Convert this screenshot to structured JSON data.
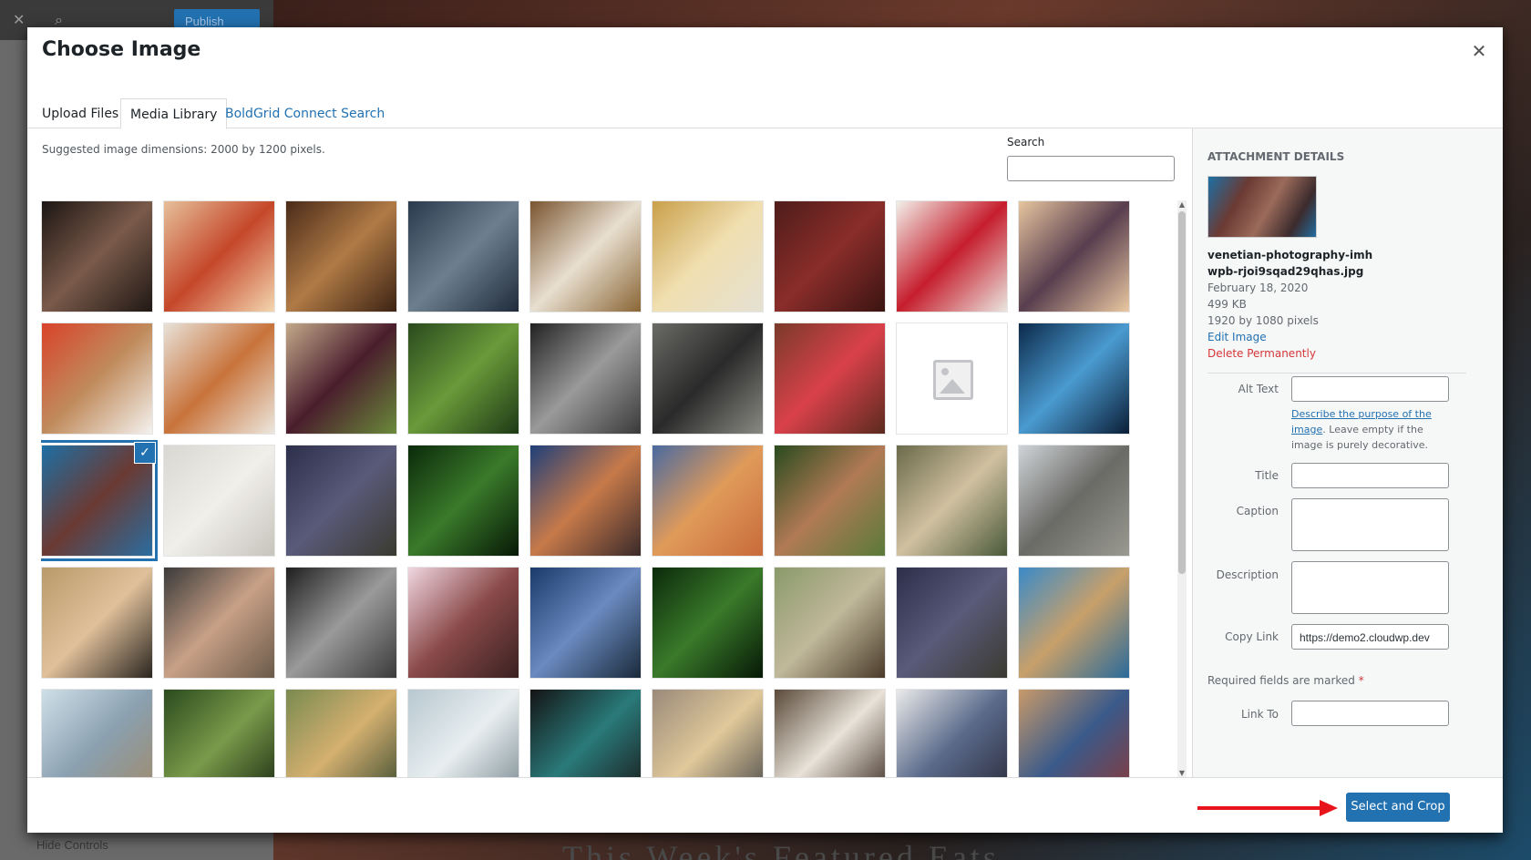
{
  "background": {
    "publish_label": "Publish",
    "hide_controls_label": "Hide Controls",
    "footer_text": "This Week's Featured Eats"
  },
  "modal": {
    "title": "Choose Image",
    "tabs": [
      {
        "label": "Upload Files"
      },
      {
        "label": "Media Library"
      },
      {
        "label": "BoldGrid Connect Search"
      }
    ],
    "suggested": "Suggested image dimensions: 2000 by 1200 pixels.",
    "search_label": "Search"
  },
  "library": {
    "selected_index": 18,
    "thumbs": [
      {
        "name": "friends-eating-popcorn",
        "colors": [
          "#1c1613",
          "#7a5a4a",
          "#201815"
        ]
      },
      {
        "name": "pizza",
        "colors": [
          "#e6c09a",
          "#c5472a",
          "#f3d6b0"
        ]
      },
      {
        "name": "sandwich",
        "colors": [
          "#4a2b19",
          "#b07a45",
          "#3c2314"
        ]
      },
      {
        "name": "sandwich-dark",
        "colors": [
          "#2a3a4d",
          "#6d7f8f",
          "#1f2b3a"
        ]
      },
      {
        "name": "spaghetti",
        "colors": [
          "#7a5530",
          "#e8dfd0",
          "#8a6636"
        ]
      },
      {
        "name": "pasta-rice",
        "colors": [
          "#c9a04a",
          "#f0dfb0",
          "#e5e0d3"
        ]
      },
      {
        "name": "jam-jars",
        "colors": [
          "#4e1d1a",
          "#8a2d2a",
          "#3a1412"
        ]
      },
      {
        "name": "raspberries",
        "colors": [
          "#f2efe9",
          "#c61e2d",
          "#eae6e0"
        ]
      },
      {
        "name": "salad-bowl",
        "colors": [
          "#e7c59f",
          "#583e4e",
          "#eac8a2"
        ]
      },
      {
        "name": "coffee-cup",
        "colors": [
          "#d9432b",
          "#c08b5c",
          "#f4f2ef"
        ]
      },
      {
        "name": "curry-pot",
        "colors": [
          "#e8e2d8",
          "#c8733b",
          "#ece7de"
        ]
      },
      {
        "name": "onion-pepper",
        "colors": [
          "#c3a98a",
          "#4a1d2d",
          "#6a8a3a"
        ]
      },
      {
        "name": "green-beans",
        "colors": [
          "#2a4a1e",
          "#6a9a3a",
          "#1e3a16"
        ]
      },
      {
        "name": "kitchen-counter",
        "colors": [
          "#222222",
          "#9a9a9a",
          "#3a3a3a"
        ]
      },
      {
        "name": "chef-kitchen",
        "colors": [
          "#6a6a66",
          "#2a2a2a",
          "#8a8a84"
        ]
      },
      {
        "name": "restaurant-street",
        "colors": [
          "#7a3a2a",
          "#d9414a",
          "#5a2a1f"
        ]
      },
      {
        "name": "no-image",
        "colors": [
          "#ffffff",
          "#ffffff",
          "#ffffff"
        ],
        "placeholder": true
      },
      {
        "name": "city-light-trails",
        "colors": [
          "#0c2a4a",
          "#4a9ad0",
          "#0b1e36"
        ]
      },
      {
        "name": "venetian-photography",
        "colors": [
          "#1d6fa5",
          "#6b3a33",
          "#2a6da0"
        ]
      },
      {
        "name": "wedding-bouquet",
        "colors": [
          "#d9d7d2",
          "#f1efea",
          "#c7c4bd"
        ]
      },
      {
        "name": "night-landscape",
        "colors": [
          "#2c2f4a",
          "#5a5a7a",
          "#3a3a30"
        ]
      },
      {
        "name": "fern-dark",
        "colors": [
          "#0b2a0b",
          "#3a7a2a",
          "#061806"
        ]
      },
      {
        "name": "girl-autumn",
        "colors": [
          "#1f3f7a",
          "#c77a4a",
          "#3a2a2a"
        ]
      },
      {
        "name": "lantern-child",
        "colors": [
          "#4a6aa0",
          "#e09a5a",
          "#c86a3a"
        ]
      },
      {
        "name": "woman-leaves",
        "colors": [
          "#2a4a1e",
          "#b07a55",
          "#5a7a3a"
        ]
      },
      {
        "name": "woman-sitting",
        "colors": [
          "#6a6a4a",
          "#d0c0a0",
          "#4a5a3a"
        ]
      },
      {
        "name": "girls-walking",
        "colors": [
          "#d0d4d8",
          "#6a6a66",
          "#9a9a92"
        ]
      },
      {
        "name": "young-man",
        "colors": [
          "#b89a6a",
          "#e0c09a",
          "#2a2520"
        ]
      },
      {
        "name": "woman-portrait",
        "colors": [
          "#3a3a3a",
          "#c8a086",
          "#6a5a4a"
        ]
      },
      {
        "name": "feet-bw",
        "colors": [
          "#1f1f1f",
          "#9a9a9a",
          "#3a3a3a"
        ]
      },
      {
        "name": "woman-sunset",
        "colors": [
          "#f0d6e0",
          "#8a4a4a",
          "#3a2020"
        ]
      },
      {
        "name": "city-night",
        "colors": [
          "#1a3a6a",
          "#6a8ac0",
          "#1a2a3a"
        ]
      },
      {
        "name": "fern-dark-2",
        "colors": [
          "#0b2a0b",
          "#3a7a2a",
          "#061806"
        ]
      },
      {
        "name": "couple-car",
        "colors": [
          "#8a9a6a",
          "#c0b89a",
          "#4a3a2a"
        ]
      },
      {
        "name": "night-landscape-2",
        "colors": [
          "#2c2f4a",
          "#5a5a7a",
          "#3a3a30"
        ]
      },
      {
        "name": "coast-cliff",
        "colors": [
          "#3a8ac8",
          "#c8a06a",
          "#2a6a9a"
        ]
      },
      {
        "name": "grass-mountains",
        "colors": [
          "#cfdfe8",
          "#8aa0b0",
          "#a08a6a"
        ]
      },
      {
        "name": "forest-trunks",
        "colors": [
          "#2a4a1e",
          "#7a9a4a",
          "#1a2a12"
        ]
      },
      {
        "name": "mountain-sunset",
        "colors": [
          "#7a8a50",
          "#d4b070",
          "#3a4a30"
        ]
      },
      {
        "name": "glacier",
        "colors": [
          "#b8c8d0",
          "#e8eef0",
          "#7a8a90"
        ]
      },
      {
        "name": "photographer",
        "colors": [
          "#141414",
          "#2a7a7a",
          "#1a1a1a"
        ]
      },
      {
        "name": "sunrise-peaks",
        "colors": [
          "#9a8a7a",
          "#e0c89a",
          "#4a4a4a"
        ]
      },
      {
        "name": "typewriter",
        "colors": [
          "#5a4a3a",
          "#e8e2d8",
          "#3a2a20"
        ]
      },
      {
        "name": "magazine-stack",
        "colors": [
          "#eaeaea",
          "#5a6a8a",
          "#2a2a3a"
        ]
      },
      {
        "name": "bookshelf",
        "colors": [
          "#c89a6a",
          "#3a5a8a",
          "#8a3a3a"
        ]
      }
    ]
  },
  "details": {
    "heading": "Attachment Details",
    "filename": "venetian-photography-imhwpb-rjoi9sqad29qhas.jpg",
    "date": "February 18, 2020",
    "size": "499 KB",
    "dimensions": "1920 by 1080 pixels",
    "edit_label": "Edit Image",
    "delete_label": "Delete Permanently",
    "alt_label": "Alt Text",
    "alt_desc_link": "Describe the purpose of the image",
    "alt_desc_rest": ". Leave empty if the image is purely decorative.",
    "title_label": "Title",
    "caption_label": "Caption",
    "description_label": "Description",
    "copy_link_label": "Copy Link",
    "copy_link_value": "https://demo2.cloudwp.dev",
    "required_text": "Required fields are marked",
    "required_star": "*",
    "link_to_label": "Link To"
  },
  "footer": {
    "select_crop_label": "Select and Crop"
  },
  "colors": {
    "accent": "#2271b1",
    "danger": "#d63638",
    "arrow": "#e8141b"
  }
}
